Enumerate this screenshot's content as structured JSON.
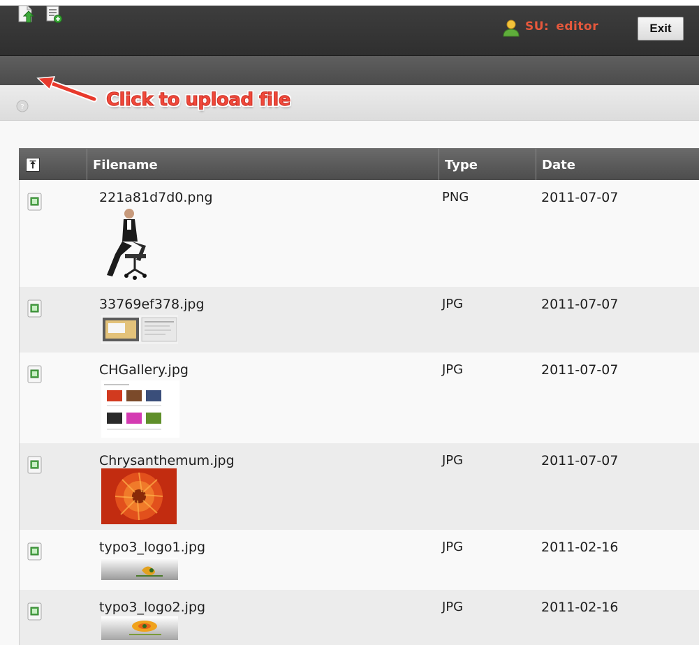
{
  "topbar": {
    "su_prefix": "SU:",
    "su_user": "editor",
    "exit_label": "Exit"
  },
  "annotation": {
    "text": "Click to upload file"
  },
  "table": {
    "columns": {
      "filename": "Filename",
      "type": "Type",
      "date": "Date"
    },
    "rows": [
      {
        "filename": "221a81d7d0.png",
        "type": "PNG",
        "date": "2011-07-07"
      },
      {
        "filename": "33769ef378.jpg",
        "type": "JPG",
        "date": "2011-07-07"
      },
      {
        "filename": "CHGallery.jpg",
        "type": "JPG",
        "date": "2011-07-07"
      },
      {
        "filename": "Chrysanthemum.jpg",
        "type": "JPG",
        "date": "2011-07-07"
      },
      {
        "filename": "typo3_logo1.jpg",
        "type": "JPG",
        "date": "2011-02-16"
      },
      {
        "filename": "typo3_logo2.jpg",
        "type": "JPG",
        "date": "2011-02-16"
      }
    ]
  },
  "colors": {
    "accent": "#e7583c",
    "annotation": "#f0483a",
    "header_bg": "#4c4c4c"
  },
  "icons": [
    "user-icon",
    "upload-file-icon",
    "new-file-icon",
    "help-icon",
    "sort-up-icon",
    "image-file-icon"
  ]
}
